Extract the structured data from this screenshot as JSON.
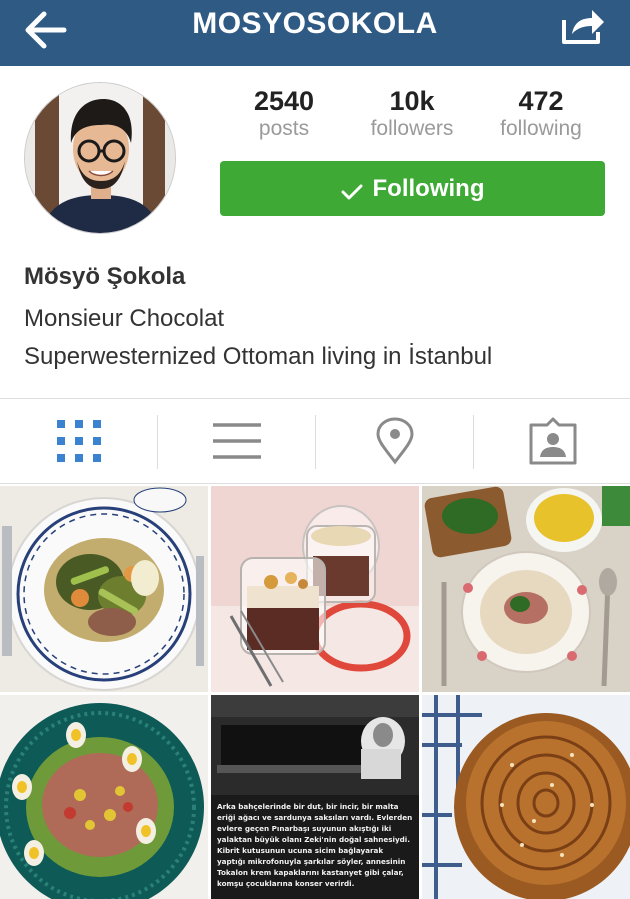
{
  "header": {
    "title": "MOSYOSOKOLA",
    "back_icon": "back-arrow-icon",
    "share_icon": "share-icon",
    "bar_color": "#2f5a84"
  },
  "profile": {
    "avatar_icon": "profile-photo",
    "stats": {
      "posts": {
        "value": "2540",
        "label": "posts"
      },
      "followers": {
        "value": "10k",
        "label": "followers"
      },
      "following": {
        "value": "472",
        "label": "following"
      }
    },
    "follow_button": {
      "label": "Following",
      "color": "#3ea935"
    },
    "name": "Mösyö Şokola",
    "subtitle": "Monsieur Chocolat",
    "bio": "Superwesternized Ottoman living in İstanbul"
  },
  "tabs": [
    {
      "icon": "grid-icon",
      "active": true,
      "color": "#3b82d0"
    },
    {
      "icon": "list-icon",
      "active": false
    },
    {
      "icon": "location-pin-icon",
      "active": false
    },
    {
      "icon": "tagged-person-icon",
      "active": false
    }
  ],
  "posts": [
    {
      "icon": "food-photo-vegetable-stew"
    },
    {
      "icon": "food-photo-jar-desserts"
    },
    {
      "icon": "food-photo-soup-with-rice"
    },
    {
      "icon": "food-photo-egg-salad"
    },
    {
      "icon": "photo-with-caption",
      "caption": "Arka bahçelerinde bir dut, bir incir, bir malta eriği ağacı ve sardunya saksıları vardı. Evlerden evlere geçen Pınarbaşı suyunun akıştığı iki yalaktan büyük olanı Zeki'nin doğal sahnesiydi. Kibrit kutusunun ucuna sicim bağlayarak yaptığı mikrofonuyla şarkılar söyler, annesinin Tokalon krem kapaklarını kastanyet gibi çalar, komşu çocuklarına konser verirdi."
    },
    {
      "icon": "food-photo-borek-pastry"
    }
  ]
}
